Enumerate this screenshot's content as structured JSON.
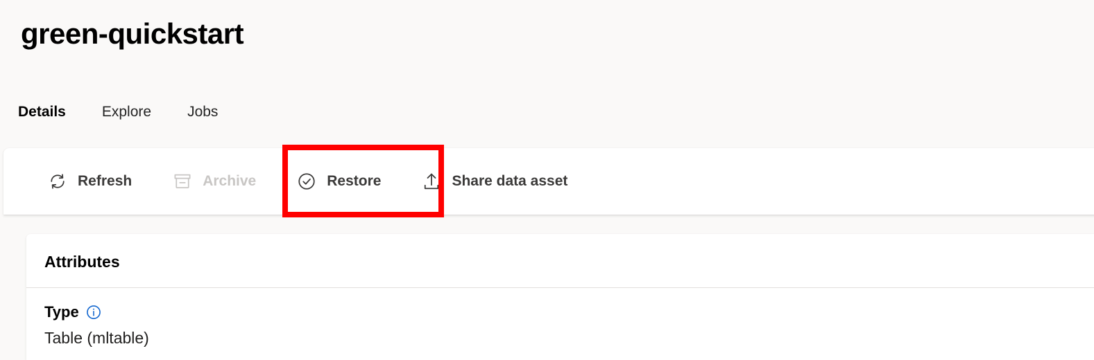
{
  "page": {
    "title": "green-quickstart",
    "background_color": "#faf9f8"
  },
  "tabs": {
    "accent_color": "#0f5fcf",
    "items": [
      {
        "label": "Details",
        "active": true
      },
      {
        "label": "Explore",
        "active": false
      },
      {
        "label": "Jobs",
        "active": false
      }
    ]
  },
  "toolbar": {
    "refresh": {
      "label": "Refresh",
      "icon": "refresh-icon",
      "disabled": false
    },
    "archive": {
      "label": "Archive",
      "icon": "archive-icon",
      "disabled": true
    },
    "restore": {
      "label": "Restore",
      "icon": "check-circle-icon",
      "disabled": false
    },
    "share": {
      "label": "Share data asset",
      "icon": "upload-share-icon",
      "disabled": false
    }
  },
  "annotation": {
    "target": "restore-button",
    "color": "#ff0000"
  },
  "attributes": {
    "heading": "Attributes",
    "rows": [
      {
        "label": "Type",
        "info_icon": "info-icon",
        "value": "Table (mltable)"
      }
    ]
  }
}
